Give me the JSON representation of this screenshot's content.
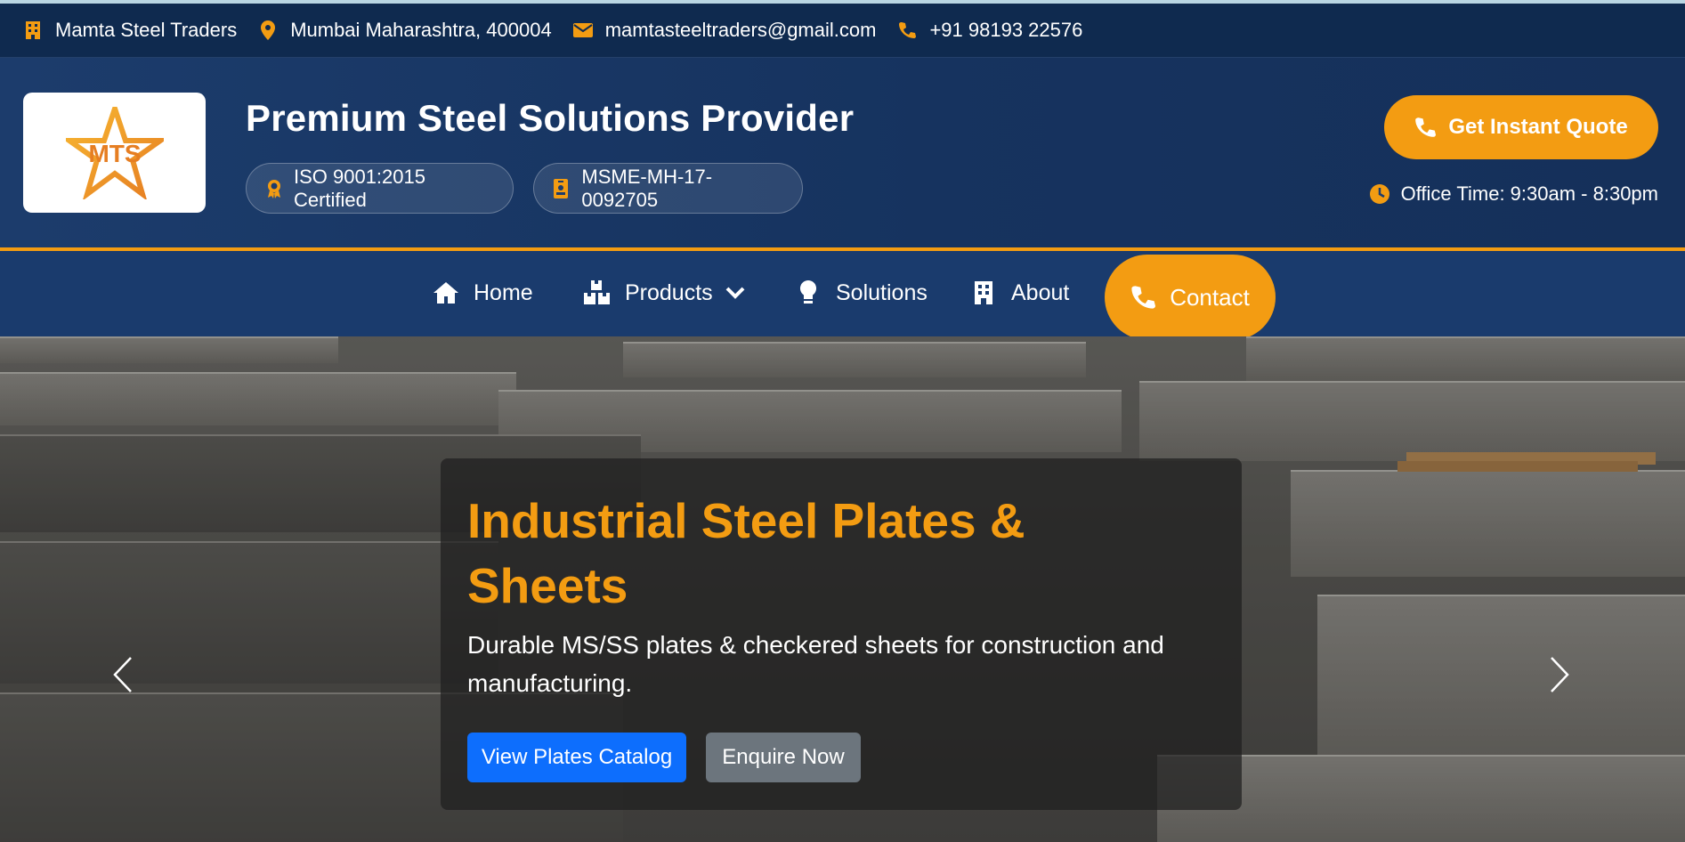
{
  "topbar": {
    "company": "Mamta Steel Traders",
    "location": "Mumbai Maharashtra, 400004",
    "email": "mamtasteeltraders@gmail.com",
    "phone": "+91 98193 22576"
  },
  "header": {
    "logo_text": "MTS",
    "title": "Premium Steel Solutions Provider",
    "badges": [
      "ISO 9001:2015 Certified",
      "MSME-MH-17-0092705"
    ],
    "quote_button": "Get Instant Quote",
    "office_time": "Office Time: 9:30am - 8:30pm"
  },
  "nav": {
    "items": [
      "Home",
      "Products",
      "Solutions",
      "About"
    ],
    "contact": "Contact"
  },
  "hero": {
    "title": "Industrial Steel Plates & Sheets",
    "text": "Durable MS/SS plates & checkered sheets for construction and manufacturing.",
    "primary_button": "View Plates Catalog",
    "secondary_button": "Enquire Now"
  },
  "colors": {
    "accent": "#f39c12",
    "navy": "#0f2a4f",
    "primary": "#0d6efd",
    "secondary": "#6c757d"
  }
}
